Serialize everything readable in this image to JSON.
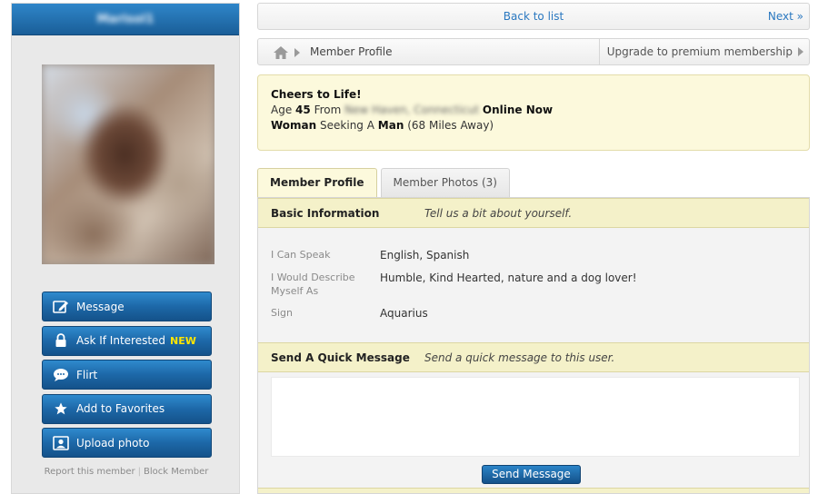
{
  "sidebar": {
    "name": "Marisol1",
    "actions": [
      {
        "label": "Message",
        "icon": "edit-icon"
      },
      {
        "label": "Ask If Interested",
        "icon": "lock-icon",
        "badge": "NEW"
      },
      {
        "label": "Flirt",
        "icon": "speech-bubble-icon"
      },
      {
        "label": "Add to Favorites",
        "icon": "star-icon"
      },
      {
        "label": "Upload photo",
        "icon": "portrait-icon"
      }
    ],
    "report_label": "Report this member",
    "block_label": "Block Member"
  },
  "topbar": {
    "back_label": "Back to list",
    "next_label": "Next »"
  },
  "breadcrumb": {
    "current": "Member Profile",
    "upgrade_label": "Upgrade to premium membership"
  },
  "summary": {
    "headline": "Cheers to Life!",
    "age_prefix": "Age",
    "age": "45",
    "from_label": "From",
    "location": "New Haven, Connecticut",
    "status": "Online Now",
    "gender": "Woman",
    "seeking_label": "Seeking A",
    "seeking": "Man",
    "distance": "(68 Miles Away)"
  },
  "tabs": [
    {
      "label": "Member Profile"
    },
    {
      "label": "Member Photos (3)"
    }
  ],
  "basic_info": {
    "title": "Basic Information",
    "subtitle": "Tell us a bit about yourself.",
    "rows": [
      {
        "label": "I Can Speak",
        "value": "English, Spanish"
      },
      {
        "label": "I Would Describe Myself As",
        "value": "Humble, Kind Hearted, nature and a dog lover!"
      },
      {
        "label": "Sign",
        "value": "Aquarius"
      }
    ]
  },
  "quick_message": {
    "title": "Send A Quick Message",
    "subtitle": "Send a quick message to this user.",
    "button_label": "Send Message"
  }
}
